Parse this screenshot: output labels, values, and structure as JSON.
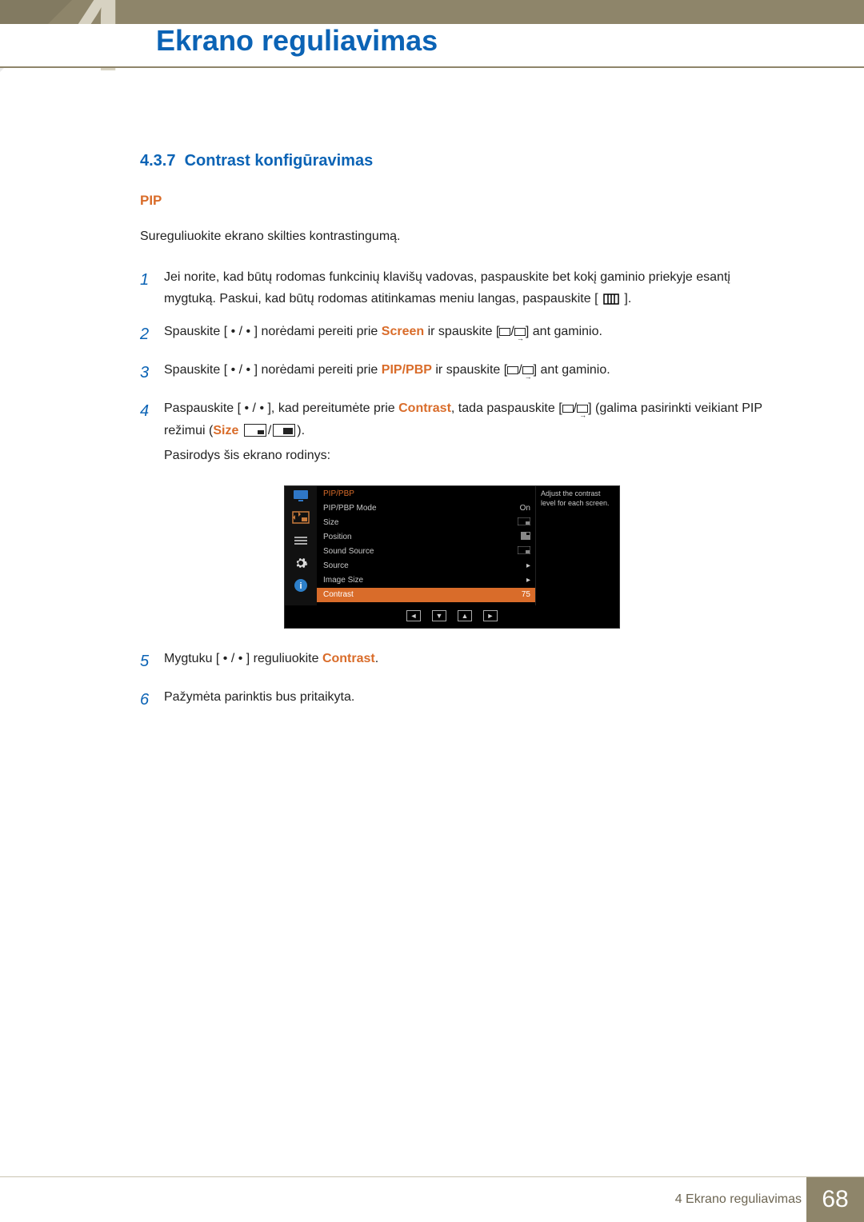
{
  "header": {
    "chapter_number_bg": "4",
    "chapter_title": "Ekrano reguliavimas"
  },
  "section": {
    "number": "4.3.7",
    "title": "Contrast konfigūravimas"
  },
  "pip_label": "PIP",
  "intro": "Sureguliuokite ekrano skilties kontrastingumą.",
  "steps": {
    "s1": "Jei norite, kad būtų rodomas funkcinių klavišų vadovas, paspauskite bet kokį gaminio priekyje esantį mygtuką. Paskui, kad būtų rodomas atitinkamas meniu langas, paspauskite [",
    "s1b": "].",
    "s2a": "Spauskite [ • / • ] norėdami pereiti prie ",
    "s2_hl": "Screen",
    "s2b": " ir spauskite [",
    "s2c": "] ant gaminio.",
    "s3a": "Spauskite [ • / • ] norėdami pereiti prie ",
    "s3_hl": "PIP/PBP",
    "s3b": " ir spauskite [",
    "s3c": "] ant gaminio.",
    "s4a": "Paspauskite [ • / • ], kad pereitumėte prie ",
    "s4_hl": "Contrast",
    "s4b": ", tada paspauskite [",
    "s4c": "] (galima pasirinkti veikiant PIP režimui (",
    "s4_size": "Size",
    "s4d": ").",
    "s4_sub": "Pasirodys šis ekrano rodinys:",
    "s5a": "Mygtuku [ • / • ] reguliuokite ",
    "s5_hl": "Contrast",
    "s5b": ".",
    "s6": "Pažymėta parinktis bus pritaikyta."
  },
  "osd": {
    "title": "PIP/PBP",
    "help": "Adjust the contrast level for each screen.",
    "rows": {
      "mode": {
        "label": "PIP/PBP Mode",
        "value": "On"
      },
      "size": {
        "label": "Size",
        "value": ""
      },
      "position": {
        "label": "Position",
        "value": ""
      },
      "sound": {
        "label": "Sound Source",
        "value": ""
      },
      "source": {
        "label": "Source",
        "value": "▸"
      },
      "image": {
        "label": "Image Size",
        "value": "▸"
      },
      "contrast": {
        "label": "Contrast",
        "value": "75"
      }
    },
    "nav": [
      "◄",
      "▼",
      "▲",
      "►"
    ]
  },
  "footer": {
    "text": "4 Ekrano reguliavimas",
    "page": "68"
  }
}
